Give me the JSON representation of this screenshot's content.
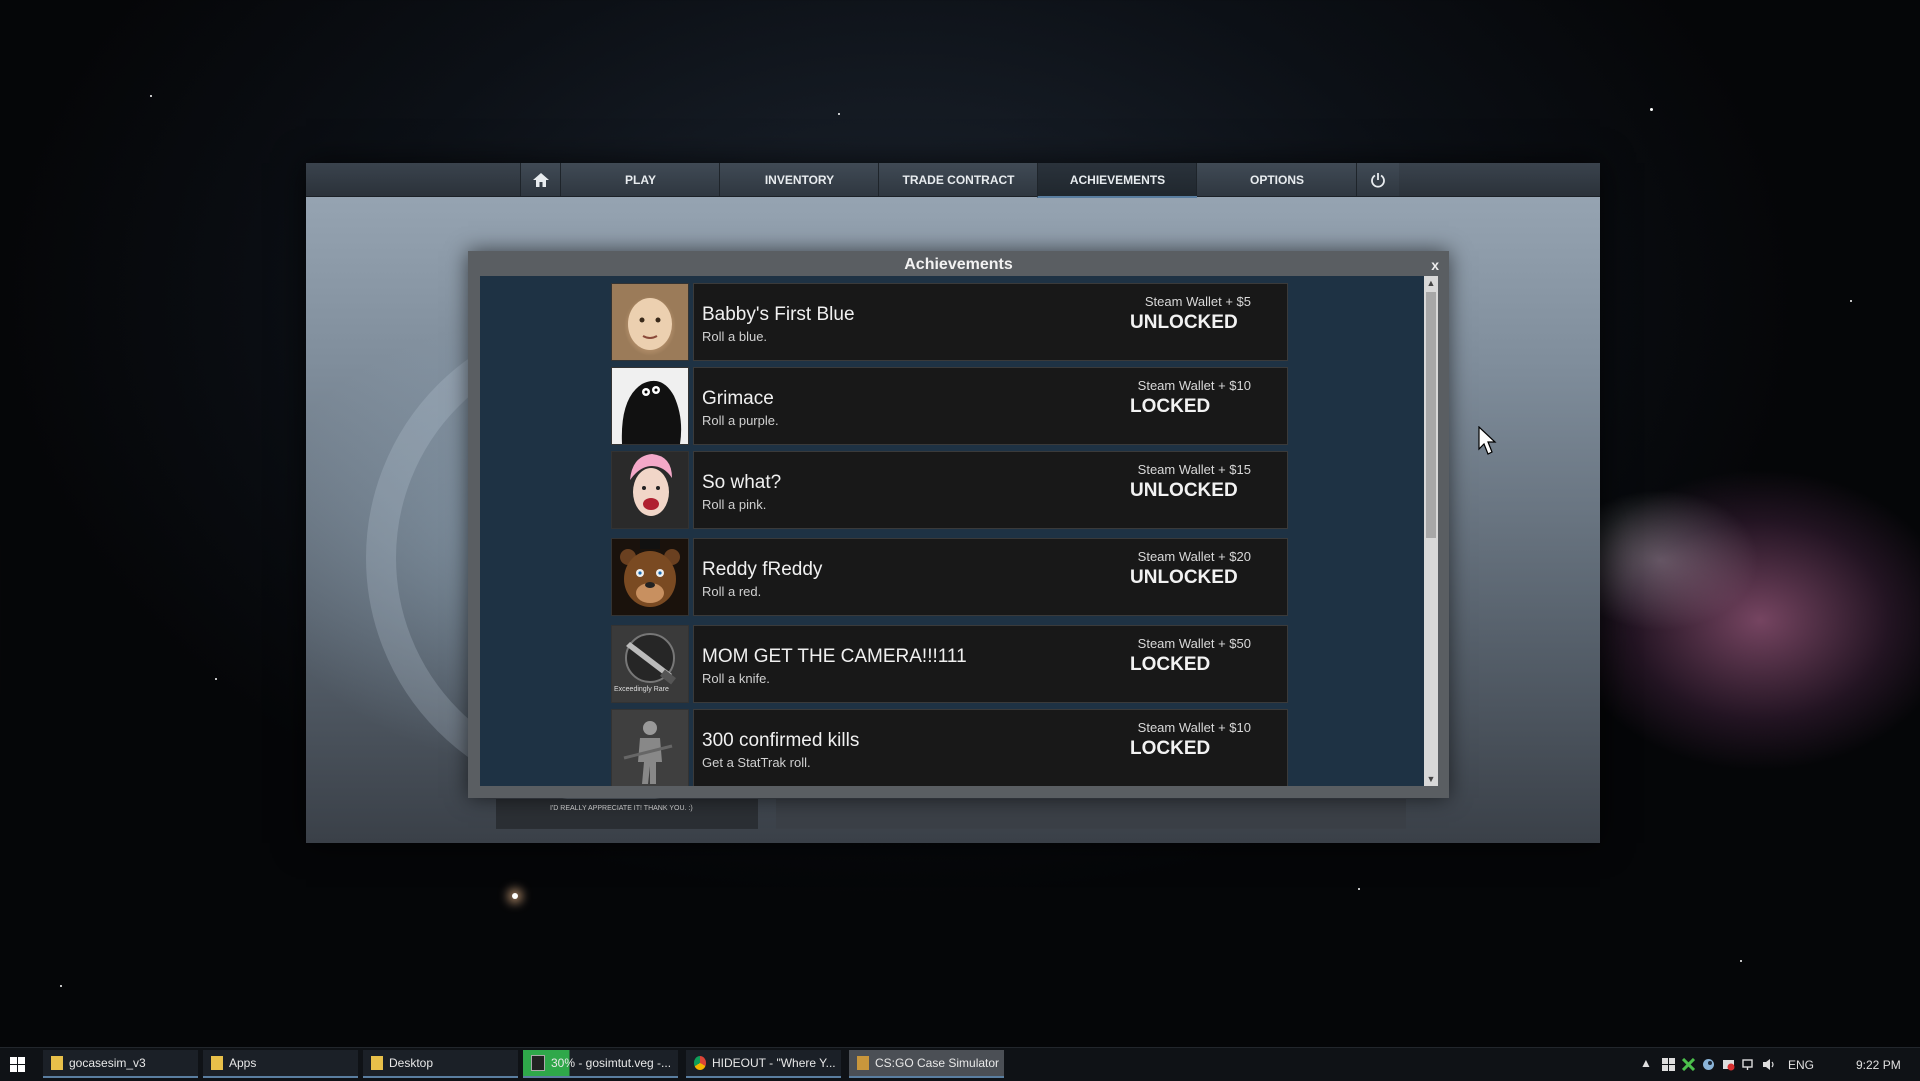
{
  "nav": {
    "home_icon": "home-icon",
    "items": [
      {
        "label": "PLAY"
      },
      {
        "label": "INVENTORY"
      },
      {
        "label": "TRADE CONTRACT"
      },
      {
        "label": "ACHIEVEMENTS"
      },
      {
        "label": "OPTIONS"
      }
    ],
    "power_icon": "power-icon"
  },
  "dialog": {
    "title": "Achievements",
    "close_label": "x",
    "achievements": [
      {
        "title": "Babby's First Blue",
        "description": "Roll a blue.",
        "reward": "Steam Wallet + $5",
        "status": "UNLOCKED",
        "image": "baby-photo"
      },
      {
        "title": "Grimace",
        "description": "Roll a purple.",
        "reward": "Steam Wallet + $10",
        "status": "LOCKED",
        "image": "grimace-photo"
      },
      {
        "title": "So what?",
        "description": "Roll a pink.",
        "reward": "Steam Wallet + $15",
        "status": "UNLOCKED",
        "image": "pink-singer-photo"
      },
      {
        "title": "Reddy fReddy",
        "description": "Roll a red.",
        "reward": "Steam Wallet + $20",
        "status": "UNLOCKED",
        "image": "freddy-photo"
      },
      {
        "title": "MOM GET THE CAMERA!!!111",
        "description": "Roll a knife.",
        "reward": "Steam Wallet + $50",
        "status": "LOCKED",
        "image": "knife-icon",
        "image_caption": "Exceedingly Rare"
      },
      {
        "title": "300 confirmed kills",
        "description": "Get a StatTrak roll.",
        "reward": "Steam Wallet + $10",
        "status": "LOCKED",
        "image": "soldier-icon"
      }
    ]
  },
  "footer": {
    "note": "I'D REALLY APPRECIATE IT! THANK YOU. :)"
  },
  "taskbar": {
    "items": [
      {
        "label": "gocasesim_v3",
        "icon": "folder-icon"
      },
      {
        "label": "Apps",
        "icon": "folder-icon"
      },
      {
        "label": "Desktop",
        "icon": "folder-icon"
      },
      {
        "label": "30% - gosimtut.veg -...",
        "icon": "vegas-icon"
      },
      {
        "label": "HIDEOUT - \"Where Y...",
        "icon": "chrome-icon"
      },
      {
        "label": "CS:GO Case Simulator",
        "icon": "case-icon"
      }
    ],
    "tray": {
      "language": "ENG",
      "time": "9:22 PM"
    }
  }
}
